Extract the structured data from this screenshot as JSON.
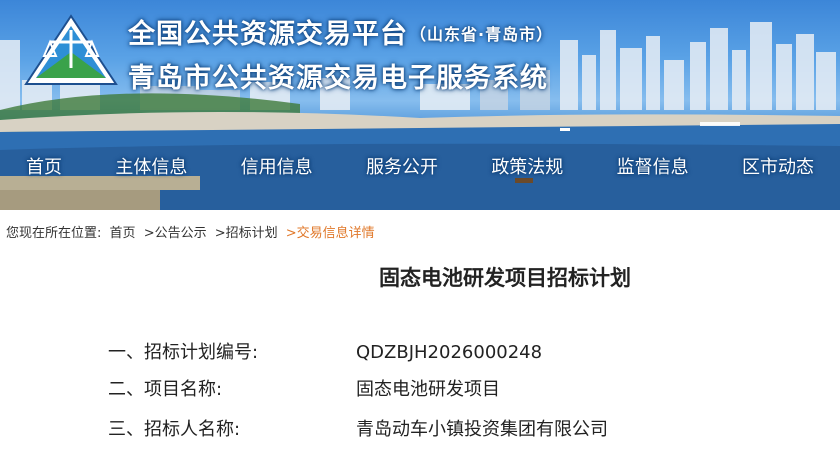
{
  "header": {
    "title_main": "全国公共资源交易平台",
    "title_sub": "（山东省·青岛市）",
    "title_line2": "青岛市公共资源交易电子服务系统"
  },
  "nav": [
    "首页",
    "主体信息",
    "信用信息",
    "服务公开",
    "政策法规",
    "监督信息",
    "区市动态"
  ],
  "breadcrumb": {
    "prefix": "您现在所在位置:",
    "items": [
      "首页",
      ">公告公示",
      ">招标计划",
      ">交易信息详情"
    ]
  },
  "page_title": "固态电池研发项目招标计划",
  "fields": [
    {
      "label": "一、招标计划编号:",
      "value": "QDZBJH2026000248"
    },
    {
      "label": "二、项目名称:",
      "value": "固态电池研发项目"
    },
    {
      "label": "三、招标人名称:",
      "value": "青岛动车小镇投资集团有限公司"
    }
  ]
}
